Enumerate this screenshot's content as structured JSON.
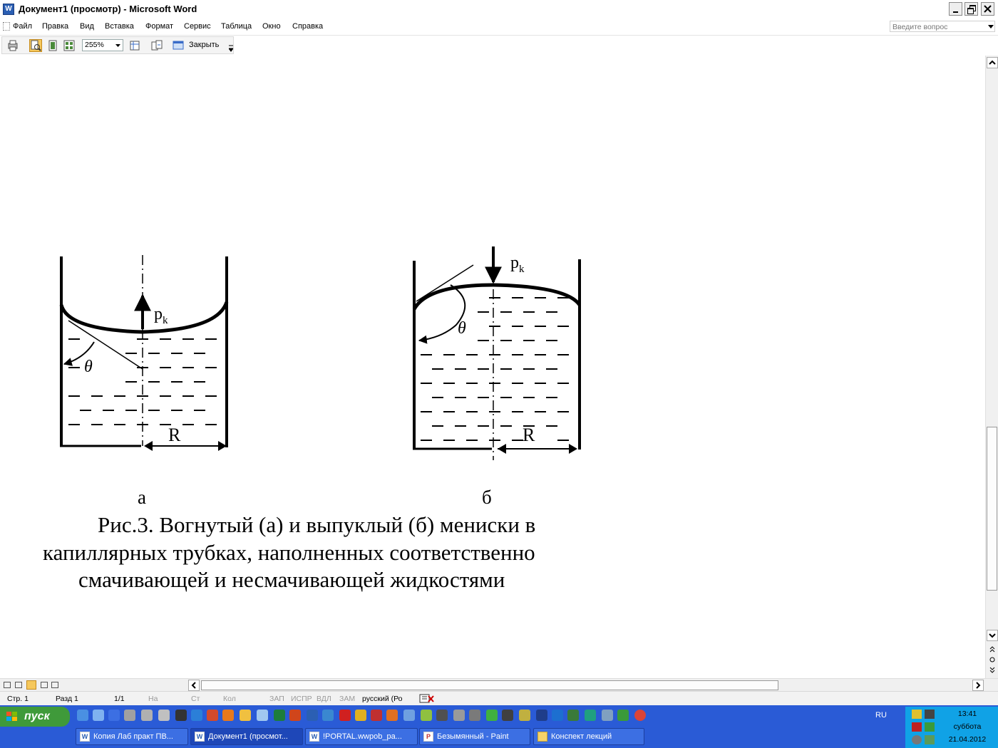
{
  "window": {
    "title": "Документ1 (просмотр) - Microsoft Word",
    "app_icon": "W"
  },
  "menu": {
    "items": [
      "Файл",
      "Правка",
      "Вид",
      "Вставка",
      "Формат",
      "Сервис",
      "Таблица",
      "Окно",
      "Справка"
    ],
    "ask_placeholder": "Введите вопрос"
  },
  "toolbar": {
    "zoom": "255%",
    "close_label": "Закрыть"
  },
  "figure": {
    "label_a": "a",
    "label_b": "б",
    "pk_main": "p",
    "pk_sub": "k",
    "theta": "θ",
    "radius": "R",
    "caption_line1": "Рис.3. Вогнутый (а) и выпуклый (б) мениски в",
    "caption_line2": "капиллярных трубках, наполненных соответственно",
    "caption_line3": "смачивающей и несмачивающей жидкостями"
  },
  "status": {
    "page": "Стр. 1",
    "section": "Разд 1",
    "pages": "1/1",
    "at": "На",
    "line": "Ст",
    "col": "Кол",
    "rec": "ЗАП",
    "trk": "ИСПР",
    "ext": "ВДЛ",
    "ovr": "ЗАМ",
    "language": "русский (Ро"
  },
  "taskbar": {
    "start_label": "пуск",
    "tasks": [
      "Копия Лаб практ ПВ...",
      "Документ1 (просмот...",
      "!PORTAL.wwpob_pa...",
      "Безымянный - Paint",
      "Конспект лекций"
    ],
    "language": "RU",
    "time": "13:41",
    "day": "суббота",
    "date": "21.04.2012"
  },
  "colors": {
    "taskbar": "#2a5bd6",
    "start": "#3f9a3a",
    "tray": "#10a2e6"
  }
}
